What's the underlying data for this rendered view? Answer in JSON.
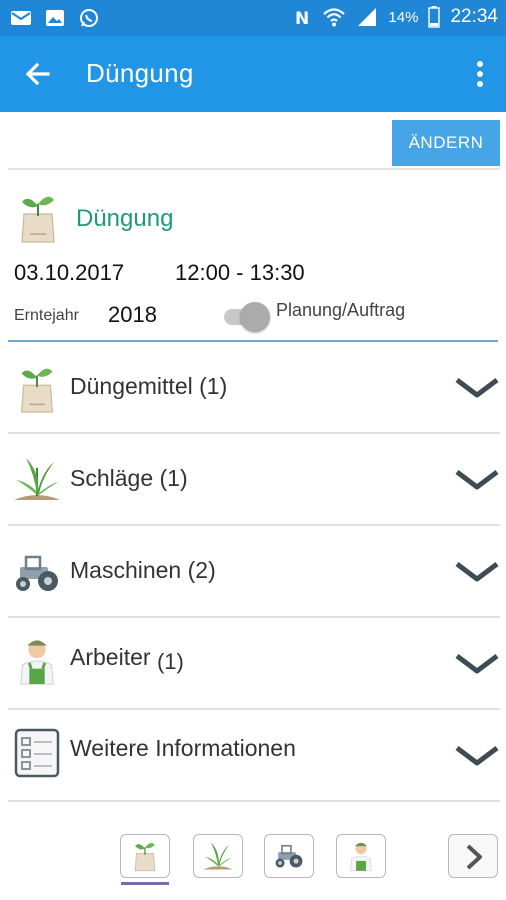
{
  "status_bar": {
    "left_icons": [
      "mail-icon",
      "image-icon",
      "whatsapp-icon"
    ],
    "right_icons": [
      "nfc-icon",
      "wifi-icon",
      "signal-icon",
      "battery-icon"
    ],
    "battery": "14%",
    "time": "22:34"
  },
  "app_bar": {
    "title": "Düngung",
    "back_icon": "arrow-back-icon",
    "menu_icon": "more-vert-icon"
  },
  "actions": {
    "edit_label": "ÄNDERN"
  },
  "header": {
    "title": "Düngung",
    "date": "03.10.2017",
    "time_range": "12:00 - 13:30",
    "harvest_year_label": "Erntejahr",
    "harvest_year": "2018",
    "toggle_label": "Planung/Auftrag",
    "toggle_on": false
  },
  "sections": [
    {
      "label": "Düngemittel (1)",
      "icon": "fertilizer-bag-icon"
    },
    {
      "label": "Schläge (1)",
      "icon": "field-plant-icon"
    },
    {
      "label": "Maschinen (2)",
      "icon": "tractor-icon"
    },
    {
      "label": "Arbeiter",
      "count": "(1)",
      "icon": "worker-icon"
    },
    {
      "label": "Weitere Informationen",
      "icon": "checklist-icon"
    }
  ],
  "bottom_nav": {
    "items": [
      "fertilizer-bag-icon",
      "field-plant-icon",
      "tractor-icon",
      "worker-icon"
    ],
    "active_index": 0,
    "next_icon": "chevron-right-icon"
  },
  "colors": {
    "status_bar": "#1f87d6",
    "app_bar": "#2196e6",
    "button": "#45a5e6",
    "title_green": "#1e9a74",
    "divider_blue": "#6aa9d8"
  }
}
